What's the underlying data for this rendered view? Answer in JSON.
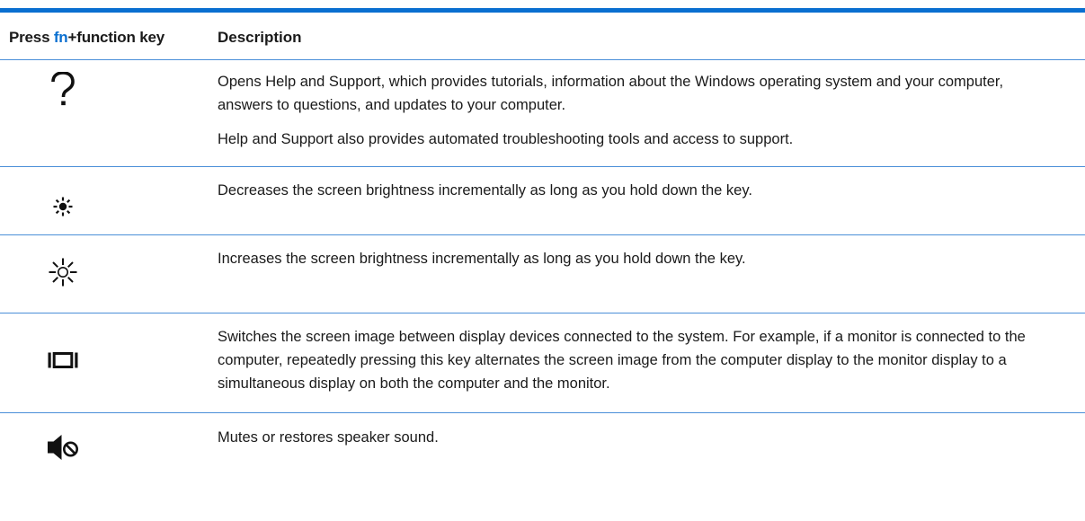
{
  "table": {
    "header": {
      "key_prefix": "Press ",
      "key_fn": "fn",
      "key_suffix": "+function key",
      "description": "Description"
    },
    "rows": [
      {
        "icon": "help-question-icon",
        "paragraphs": [
          "Opens Help and Support, which provides tutorials, information about the Windows operating system and your computer, answers to questions, and updates to your computer.",
          "Help and Support also provides automated troubleshooting tools and access to support."
        ]
      },
      {
        "icon": "brightness-down-icon",
        "paragraphs": [
          "Decreases the screen brightness incrementally as long as you hold down the key."
        ]
      },
      {
        "icon": "brightness-up-icon",
        "paragraphs": [
          "Increases the screen brightness incrementally as long as you hold down the key."
        ]
      },
      {
        "icon": "display-switch-icon",
        "paragraphs": [
          "Switches the screen image between display devices connected to the system. For example, if a monitor is connected to the computer, repeatedly pressing this key alternates the screen image from the computer display to the monitor display to a simultaneous display on both the computer and the monitor."
        ]
      },
      {
        "icon": "mute-speaker-icon",
        "paragraphs": [
          "Mutes or restores speaker sound."
        ]
      }
    ]
  },
  "colors": {
    "accent": "#0a6fd0",
    "rule": "#4a8fd8",
    "text": "#1a1a1a"
  }
}
